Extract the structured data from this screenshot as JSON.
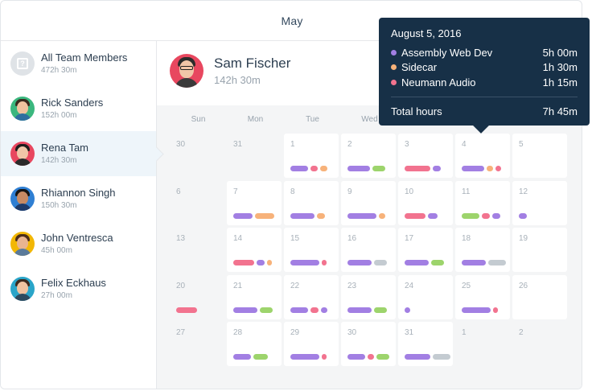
{
  "header": {
    "month": "May"
  },
  "sidebar": {
    "team": {
      "name": "All Team Members",
      "hours": "472h 30m"
    },
    "members": [
      {
        "name": "Rick Sanders",
        "hours": "152h 00m",
        "bg": "#3bb77e",
        "hair": "#3a2a1e",
        "skin": "#f0c39e",
        "body": "#2f6f9f"
      },
      {
        "name": "Rena Tam",
        "hours": "142h 30m",
        "bg": "#e8475f",
        "hair": "#1e1e1e",
        "skin": "#f1c6a8",
        "body": "#2a2a2a",
        "active": true
      },
      {
        "name": "Rhiannon Singh",
        "hours": "150h 30m",
        "bg": "#2f7fd3",
        "hair": "#151515",
        "skin": "#c68a64",
        "body": "#1e3b6a"
      },
      {
        "name": "John Ventresca",
        "hours": "45h 00m",
        "bg": "#f2b705",
        "hair": "#4b2d1a",
        "skin": "#e9b48f",
        "body": "#5a7a9a"
      },
      {
        "name": "Felix Eckhaus",
        "hours": "27h 00m",
        "bg": "#2aa5c9",
        "hair": "#3d2b1f",
        "skin": "#efc3a0",
        "body": "#2d4a5f"
      }
    ]
  },
  "profile": {
    "name": "Sam Fischer",
    "hours": "142h 30m"
  },
  "calendar": {
    "weekdays": [
      "Sun",
      "Mon",
      "Tue",
      "Wed",
      "Thu",
      "Fri",
      "Sat"
    ],
    "colors": {
      "purple": "#a27fe3",
      "green": "#9dd46c",
      "pink": "#f2738f",
      "orange": "#f7b27a",
      "gray": "#c4cbd1"
    },
    "weeks": [
      [
        {
          "num": "30",
          "out": true,
          "bars": []
        },
        {
          "num": "31",
          "out": true,
          "bars": []
        },
        {
          "num": "1",
          "bars": [
            [
              "purple",
              22
            ],
            [
              "pink",
              9
            ],
            [
              "orange",
              9
            ]
          ]
        },
        {
          "num": "2",
          "bars": [
            [
              "purple",
              28
            ],
            [
              "green",
              16
            ]
          ]
        },
        {
          "num": "3",
          "bars": [
            [
              "pink",
              32
            ],
            [
              "purple",
              10
            ]
          ]
        },
        {
          "num": "4",
          "bars": [
            [
              "purple",
              28
            ],
            [
              "orange",
              8
            ],
            [
              "pink",
              7
            ]
          ]
        },
        {
          "num": "5",
          "bars": []
        }
      ],
      [
        {
          "num": "6",
          "out": true,
          "bars": []
        },
        {
          "num": "7",
          "bars": [
            [
              "purple",
              24
            ],
            [
              "orange",
              24
            ]
          ]
        },
        {
          "num": "8",
          "bars": [
            [
              "purple",
              30
            ],
            [
              "orange",
              10
            ]
          ]
        },
        {
          "num": "9",
          "bars": [
            [
              "purple",
              36
            ],
            [
              "orange",
              8
            ]
          ]
        },
        {
          "num": "10",
          "bars": [
            [
              "pink",
              26
            ],
            [
              "purple",
              12
            ]
          ]
        },
        {
          "num": "11",
          "bars": [
            [
              "green",
              22
            ],
            [
              "pink",
              10
            ],
            [
              "purple",
              10
            ]
          ]
        },
        {
          "num": "12",
          "bars": [
            [
              "purple",
              10
            ]
          ]
        }
      ],
      [
        {
          "num": "13",
          "out": true,
          "bars": []
        },
        {
          "num": "14",
          "bars": [
            [
              "pink",
              26
            ],
            [
              "purple",
              10
            ],
            [
              "orange",
              6
            ]
          ]
        },
        {
          "num": "15",
          "bars": [
            [
              "purple",
              36
            ],
            [
              "pink",
              6
            ]
          ]
        },
        {
          "num": "16",
          "bars": [
            [
              "purple",
              30
            ],
            [
              "gray",
              16
            ]
          ]
        },
        {
          "num": "17",
          "bars": [
            [
              "purple",
              30
            ],
            [
              "green",
              16
            ]
          ]
        },
        {
          "num": "18",
          "bars": [
            [
              "purple",
              30
            ],
            [
              "gray",
              22
            ]
          ]
        },
        {
          "num": "19",
          "bars": []
        }
      ],
      [
        {
          "num": "20",
          "out": true,
          "bars": [
            [
              "pink",
              26
            ]
          ]
        },
        {
          "num": "21",
          "bars": [
            [
              "purple",
              30
            ],
            [
              "green",
              16
            ]
          ]
        },
        {
          "num": "22",
          "bars": [
            [
              "purple",
              22
            ],
            [
              "pink",
              10
            ],
            [
              "purple",
              8
            ]
          ]
        },
        {
          "num": "23",
          "bars": [
            [
              "purple",
              30
            ],
            [
              "green",
              16
            ]
          ]
        },
        {
          "num": "24",
          "bars": [
            [
              "purple",
              7
            ]
          ]
        },
        {
          "num": "25",
          "bars": [
            [
              "purple",
              36
            ],
            [
              "pink",
              6
            ]
          ]
        },
        {
          "num": "26",
          "bars": []
        }
      ],
      [
        {
          "num": "27",
          "out": true,
          "bars": []
        },
        {
          "num": "28",
          "bars": [
            [
              "purple",
              22
            ],
            [
              "green",
              18
            ]
          ]
        },
        {
          "num": "29",
          "bars": [
            [
              "purple",
              36
            ],
            [
              "pink",
              6
            ]
          ]
        },
        {
          "num": "30",
          "bars": [
            [
              "purple",
              22
            ],
            [
              "pink",
              8
            ],
            [
              "green",
              16
            ]
          ]
        },
        {
          "num": "31",
          "bars": [
            [
              "purple",
              32
            ],
            [
              "gray",
              22
            ]
          ]
        },
        {
          "num": "1",
          "out": true,
          "bars": []
        },
        {
          "num": "2",
          "out": true,
          "bars": []
        }
      ]
    ]
  },
  "tooltip": {
    "date": "August 5, 2016",
    "rows": [
      {
        "label": "Assembly Web Dev",
        "value": "5h 00m",
        "color": "#a27fe3"
      },
      {
        "label": "Sidecar",
        "value": "1h 30m",
        "color": "#f7b27a"
      },
      {
        "label": "Neumann Audio",
        "value": "1h 15m",
        "color": "#f2738f"
      }
    ],
    "total_label": "Total hours",
    "total_value": "7h 45m"
  }
}
